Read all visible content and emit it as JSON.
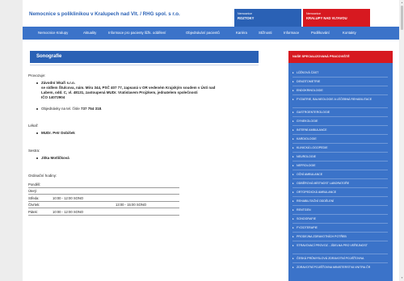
{
  "header": {
    "title": "Nemocnice s poliklinikou v Kralupech nad Vlt. / RHG spol. s r.o.",
    "box1": {
      "line1": "Nemocnice",
      "line2": "ROZTOKY"
    },
    "box2": {
      "line1": "Nemocnice",
      "line2": "KRALUPY NAD VLTAVOU"
    }
  },
  "nav": [
    "Nemocnice Kralupy",
    "Aktuality",
    "Informace pro pacienty lůžk. oddělení",
    "Objednávání pacientů",
    "Kariéra",
    "Stížnosti",
    "Informace",
    "Poděkování",
    "Kontakty"
  ],
  "main": {
    "title": "Sonografie",
    "provozuje_label": "Provozuje:",
    "company_name": "Závodní lékaři s.r.o.",
    "company_lines": [
      "se sídlem Štulcova, nám. Míru 344, PSČ 407 77, zapsaná v OR vedeném Krajským soudem v Ústí nad",
      "Labem, odd. C, vl. 48131, zastoupená MUDr. Vratislavem Projzkem, jednatelem společnosti",
      "IČO 14072904"
    ],
    "order_text": "Objednávky na tel. čísle",
    "order_phone": "737 754 318",
    "order_end": ".",
    "lekar_label": "Lékař:",
    "lekar_name": "MUDr. Petr Dobišek",
    "sestra_label": "Sestra:",
    "sestra_name": "Jitka Motlíčková",
    "hours_label": "Ordinační hodiny:",
    "hours": [
      {
        "day": "Pondělí:",
        "t1": "",
        "t2": ""
      },
      {
        "day": "Úterý:",
        "t1": "",
        "t2": ""
      },
      {
        "day": "Středa:",
        "t1": "10:00 - 12:00 SONO",
        "t2": ""
      },
      {
        "day": "Čtvrtek:",
        "t1": "",
        "t2": "13:00 - 15:00 SONO"
      },
      {
        "day": "Pátek:",
        "t1": "10:00 - 12:00 SONO",
        "t2": ""
      }
    ]
  },
  "sidebar": {
    "title": "NAŠE SPECIALIZOVANÁ PRACOVIŠTĚ",
    "items": [
      "LŮŽKOVÁ ČÁST",
      "DENZITOMETRIE",
      "ENDOKRINOLOGIE",
      "FYZIATRIE, BALNEOLOGIE A LÉČEBNÁ REHABILITACE",
      "GASTROENTEROLOGIE",
      "GYNEKOLOGIE",
      "INTERNÍ AMBULANCE",
      "KARDIOLOGIE",
      "KLINICKÁ LOGOPEDIE",
      "NEUROLOGIE",
      "NEFROLOGIE",
      "OČNÍ AMBULANCE",
      "ODBĚROVÁ MÍSTNOST LABORATOŘE",
      "ORTOPEDICKÁ AMBULANCE",
      "REHABILITAČNÍ ODDĚLENÍ",
      "RENTGEN",
      "SONOGRAFIE",
      "FYZIOTERAPIE",
      "PRODEJNA ZDRAVOTNÍCH POTŘEB",
      "STRAVOVACÍ PROVOZ - JÍDELNA PRO VEŘEJNOST",
      "ČESKÁ PRŮMYSLOVÁ ZDRAVOTNÍ POJIŠŤOVNA",
      "ZDRAVOTNÍ POJIŠŤOVNA MINISTERSTVA VNITRA ČR"
    ]
  }
}
